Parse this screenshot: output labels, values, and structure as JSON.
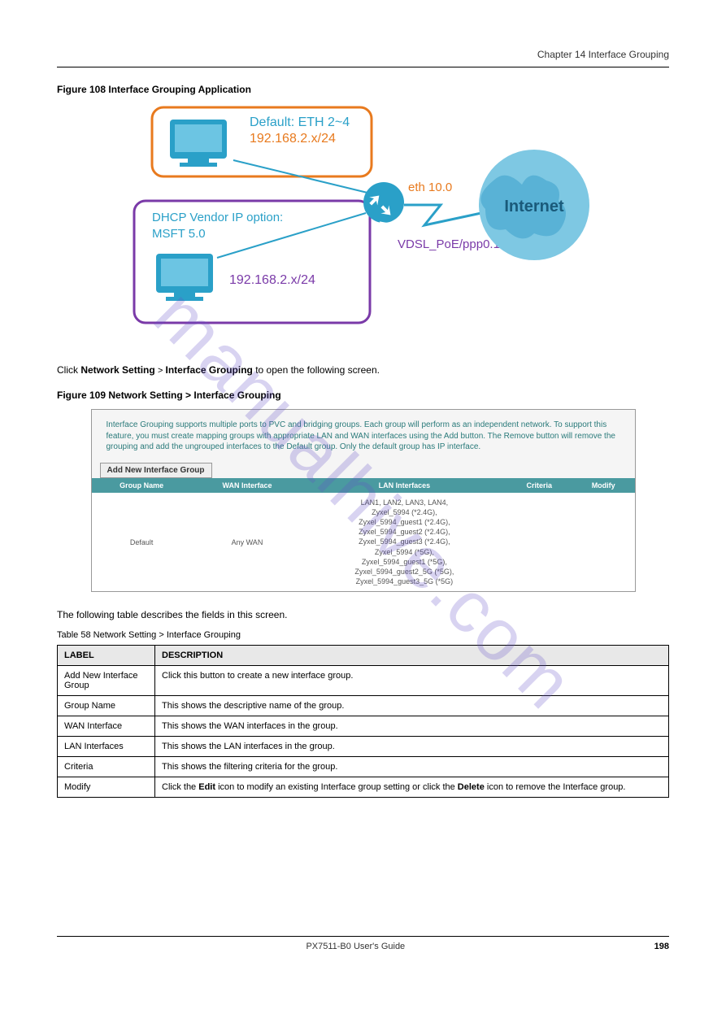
{
  "header": {
    "chapter": "Chapter 14 Interface Grouping"
  },
  "figure108": {
    "label": "Figure 108   Interface Grouping Application",
    "box1_title": "Default: ETH 2~4",
    "box1_ip": "192.168.2.x/24",
    "box2_title": "DHCP Vendor IP option: MSFT 5.0",
    "box2_ip": "192.168.2.x/24",
    "eth_label": "eth 10.0",
    "vdsl_label": "VDSL_PoE/ppp0.1",
    "internet": "Internet"
  },
  "body1": {
    "p1_a": "Click ",
    "p1_b": "Network Setting",
    "p1_c": "Interface Grouping",
    "p1_d": " to open the following screen."
  },
  "figure109": {
    "label": "Figure 109   Network Setting > Interface Grouping",
    "desc": "Interface Grouping supports multiple ports to PVC and bridging groups. Each group will perform as an independent network. To support this feature, you must create mapping groups with appropriate LAN and WAN interfaces using the Add button. The Remove button will remove the grouping and add the ungrouped interfaces to the Default group. Only the default group has IP interface.",
    "add_btn": "Add New Interface Group",
    "th": {
      "group": "Group Name",
      "wan": "WAN Interface",
      "lan": "LAN Interfaces",
      "criteria": "Criteria",
      "modify": "Modify"
    },
    "row": {
      "group": "Default",
      "wan": "Any WAN",
      "lan": [
        "LAN1, LAN2, LAN3, LAN4,",
        "Zyxel_5994 (*2.4G),",
        "Zyxel_5994_guest1 (*2.4G),",
        "Zyxel_5994_guest2 (*2.4G),",
        "Zyxel_5994_guest3 (*2.4G),",
        "Zyxel_5994 (*5G),",
        "Zyxel_5994_guest1 (*5G),",
        "Zyxel_5994_guest2_5G (*5G),",
        "Zyxel_5994_guest3_5G (*5G)"
      ]
    }
  },
  "body2": {
    "text": "The following table describes the fields in this screen."
  },
  "table58": {
    "caption": "Table 58   Network Setting > Interface Grouping",
    "th": {
      "label": "LABEL",
      "desc": "DESCRIPTION"
    },
    "rows": [
      {
        "label": "Add New Interface Group",
        "desc": "Click this button to create a new interface group."
      },
      {
        "label": "Group Name",
        "desc": "This shows the descriptive name of the group."
      },
      {
        "label": "WAN Interface",
        "desc": "This shows the WAN interfaces in the group."
      },
      {
        "label": "LAN Interfaces",
        "desc": "This shows the LAN interfaces in the group."
      },
      {
        "label": "Criteria",
        "desc": "This shows the filtering criteria for the group."
      },
      {
        "label": "Modify",
        "desc": "Click the Edit icon to modify an existing Interface group setting or click the Delete icon to remove the Interface group."
      }
    ]
  },
  "footer": {
    "title": "PX7511-B0 User's Guide",
    "page": "198"
  },
  "watermark": "manualhive.com"
}
